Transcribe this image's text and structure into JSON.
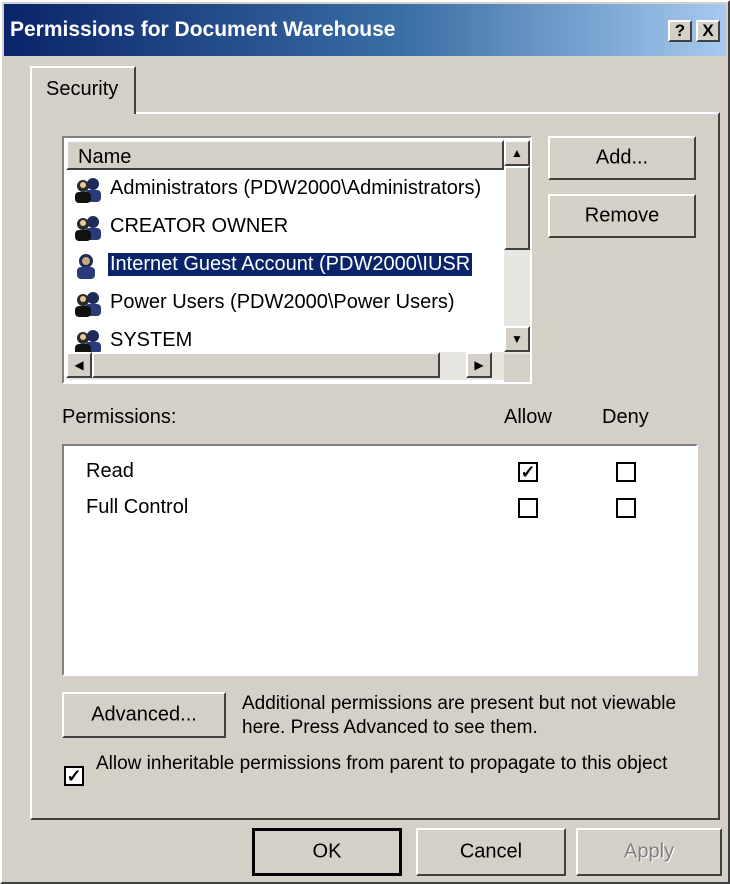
{
  "window": {
    "title": "Permissions for Document Warehouse",
    "help_label": "?",
    "close_label": "X"
  },
  "tabs": [
    {
      "label": "Security"
    }
  ],
  "name_list": {
    "header": "Name",
    "items": [
      {
        "label": "Administrators (PDW2000\\Administrators)",
        "icon": "group-icon",
        "selected": false
      },
      {
        "label": "CREATOR OWNER",
        "icon": "group-icon",
        "selected": false
      },
      {
        "label": "Internet Guest Account (PDW2000\\IUSR",
        "icon": "user-icon",
        "selected": true
      },
      {
        "label": "Power Users (PDW2000\\Power Users)",
        "icon": "group-icon",
        "selected": false
      },
      {
        "label": "SYSTEM",
        "icon": "group-icon",
        "selected": false
      }
    ]
  },
  "buttons": {
    "add": "Add...",
    "remove": "Remove",
    "advanced": "Advanced...",
    "ok": "OK",
    "cancel": "Cancel",
    "apply": "Apply"
  },
  "permissions": {
    "label": "Permissions:",
    "allow_header": "Allow",
    "deny_header": "Deny",
    "rows": [
      {
        "name": "Read",
        "allow": true,
        "deny": false
      },
      {
        "name": "Full Control",
        "allow": false,
        "deny": false
      }
    ]
  },
  "advanced_note": "Additional permissions are present but not viewable here. Press Advanced to see them.",
  "inherit": {
    "label": "Allow inheritable permissions from parent to propagate to this object",
    "checked": true
  },
  "colors": {
    "title_gradient_start": "#0a246a",
    "title_gradient_end": "#a6caf0",
    "selection": "#0a246a",
    "face": "#d4d0c8"
  }
}
